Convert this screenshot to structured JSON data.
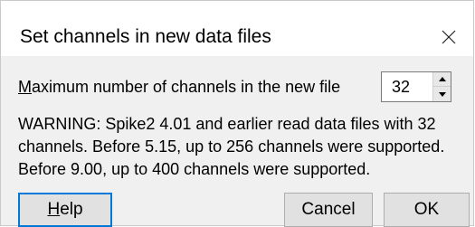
{
  "dialog": {
    "title": "Set channels in new data files",
    "close_glyph": "×"
  },
  "channels": {
    "label_accel": "M",
    "label_rest": "aximum number of channels in the new file",
    "value": "32"
  },
  "warning": {
    "text": "WARNING: Spike2 4.01 and earlier read data files with 32\nchannels. Before 5.15, up to 256 channels were supported.\nBefore 9.00, up to 400 channels were supported."
  },
  "buttons": {
    "help_accel": "H",
    "help_rest": "elp",
    "cancel": "Cancel",
    "ok": "OK"
  },
  "colors": {
    "focus_border": "#0078d7",
    "client_bg": "#f0f0f0"
  }
}
